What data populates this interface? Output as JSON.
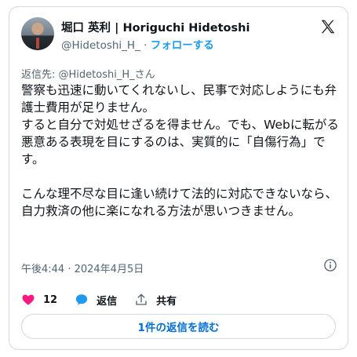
{
  "author": {
    "display_name": "堀口 英利 | Horiguchi Hidetoshi",
    "handle": "@Hidetoshi_H_",
    "separator": "·",
    "follow_label": "フォローする"
  },
  "reply_to": {
    "prefix": "返信先: ",
    "handle": "@Hidetoshi_H_さん"
  },
  "tweet": {
    "text": "警察も迅速に動いてくれないし、民事で対応しようにも弁護士費用が足りません。\nすると自分で対処せざるを得ません。でも、Webに転がる悪意ある表現を目にするのは、実質的に「自傷行為」です。\n\nこんな理不尽な目に逢い続けて法的に対応できないなら、自力救済の他に楽になれる方法が思いつきません。",
    "timestamp": "午後4:44 · 2024年4月5日"
  },
  "actions": {
    "like_count": "12",
    "reply_label": "返信",
    "share_label": "共有"
  },
  "read_replies_label": "1件の返信を読む",
  "icons": {
    "logo": "x-logo-icon",
    "info": "info-icon",
    "like": "heart-icon",
    "reply": "speech-bubble-icon",
    "share": "share-icon"
  },
  "colors": {
    "link_blue": "#1d9bf0",
    "heart_pink": "#f91880",
    "secondary_text": "#536471",
    "border": "#cfd9de"
  }
}
